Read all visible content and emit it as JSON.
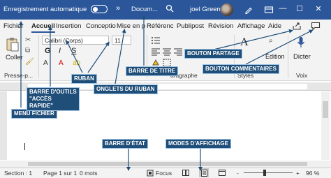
{
  "title_bar": {
    "autosave_label": "Enregistrement automatique",
    "more": "»",
    "document_name": "Docum...",
    "user_name": "joel Green",
    "controls": {
      "minimize": "—",
      "restore": "☐",
      "close": "✕"
    }
  },
  "tabs": [
    {
      "label": "Fichier",
      "active": false
    },
    {
      "label": "Accueil",
      "active": true
    },
    {
      "label": "Insertion",
      "active": false
    },
    {
      "label": "Conceptio",
      "active": false
    },
    {
      "label": "Mise en p",
      "active": false
    },
    {
      "label": "Référenc",
      "active": false
    },
    {
      "label": "Publipost",
      "active": false
    },
    {
      "label": "Révision",
      "active": false
    },
    {
      "label": "Affichage",
      "active": false
    },
    {
      "label": "Aide",
      "active": false
    }
  ],
  "ribbon": {
    "paste_label": "Coller",
    "font_name": "Calibri (Corps)",
    "font_size": "11",
    "format_buttons": [
      "G",
      "I",
      "S"
    ],
    "groups": {
      "clipboard": "Presse-p...",
      "paragraph": "aragraphe",
      "styles": "Styles",
      "voice": "Voix"
    },
    "editing_label": "Édition",
    "dictate_label": "Dicter"
  },
  "annotations": {
    "file_menu": "MENU FICHIER",
    "quick_access": "BARRE D'OUTILS \"ACCÈS RAPIDE\"",
    "ribbon": "RUBAN",
    "ribbon_tabs": "ONGLETS DU RUBAN",
    "title_bar": "BARRE DE TITRE",
    "share_button": "BOUTON PARTAGE",
    "comments_button": "BOUTON COMMENTAIRES",
    "status_bar": "BARRE D'ÉTAT",
    "view_modes": "MODES D'AFFICHAGE"
  },
  "status_bar": {
    "section": "Section : 1",
    "page": "Page 1 sur 1",
    "words": "0 mots",
    "focus": "Focus",
    "zoom_minus": "-",
    "zoom_plus": "+",
    "zoom": "96 %"
  },
  "colors": {
    "title_bar": "#2b579a",
    "callout_bg": "#1f4e79",
    "arrow": "#1f4e79"
  },
  "icons": [
    "search-icon",
    "pen-icon",
    "ribbon-display-icon",
    "share-icon",
    "comment-icon",
    "clipboard-icon",
    "microphone-icon",
    "focus-icon"
  ]
}
